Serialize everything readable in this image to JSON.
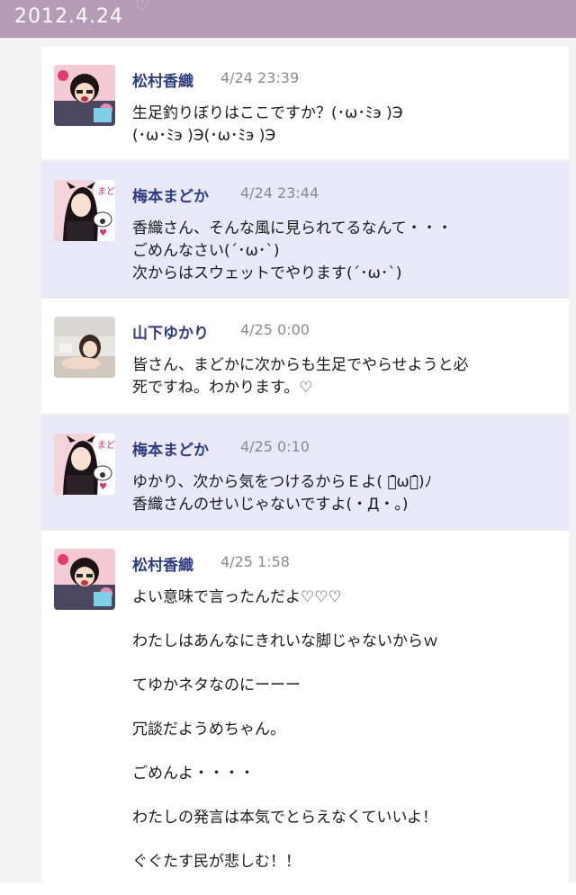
{
  "date_header": "2012.4.24",
  "comments": [
    {
      "author": "松村香織",
      "time": "4/24 23:39",
      "lines": [
        "生足釣りぼりはここですか？(･ω･ﾐэ )Э",
        "(･ω･ﾐэ )Э(･ω･ﾐэ )Э"
      ]
    },
    {
      "author": "梅本まどか",
      "time": "4/24 23:44",
      "lines": [
        "香織さん、そんな風に見られてるなんて・・・",
        "ごめんなさい(´･ω･`)",
        "次からはスウェットでやります(´･ω･`)"
      ]
    },
    {
      "author": "山下ゆかり",
      "time": "4/25 0:00",
      "lines": [
        "皆さん、まどかに次からも生足でやらせようと必",
        "死ですね。わかります。♡"
      ]
    },
    {
      "author": "梅本まどか",
      "time": "4/25 0:10",
      "lines": [
        "ゆかり、次から気をつけるからＥよ( ･̑̑ω･̑̑)ﾉ",
        "香織さんのせいじゃないですよ(・Д・。)"
      ]
    },
    {
      "author": "松村香織",
      "time": "4/25 1:58",
      "paragraphs": [
        "よい意味で言ったんだよ♡♡♡",
        "わたしはあんなにきれいな脚じゃないからｗ",
        "てゆかネタなのにーーー",
        "冗談だようめちゃん。",
        "ごめんよ・・・・",
        "わたしの発言は本気でとらえなくていいよ！",
        "ぐぐたす民が悲しむ！！"
      ]
    }
  ]
}
